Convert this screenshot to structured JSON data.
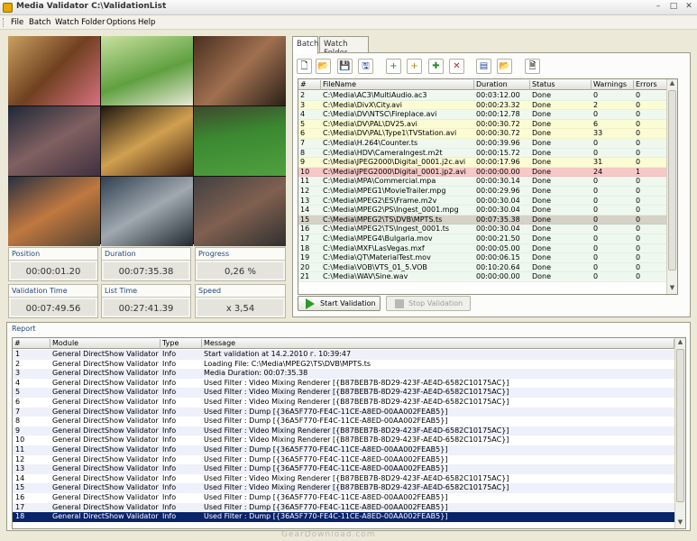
{
  "window": {
    "title": "Media Validator C:\\ValidationList"
  },
  "menu": [
    "File",
    "Batch",
    "Watch Folder",
    "Options",
    "Help"
  ],
  "stats": {
    "position_label": "Position",
    "position_value": "00:00:01.20",
    "duration_label": "Duration",
    "duration_value": "00:07:35.38",
    "progress_label": "Progress",
    "progress_value": "0,26 %",
    "validation_time_label": "Validation Time",
    "validation_time_value": "00:07:49.56",
    "list_time_label": "List Time",
    "list_time_value": "00:27:41.39",
    "speed_label": "Speed",
    "speed_value": "x 3,54"
  },
  "tabs": [
    "Batch",
    "Watch Folder"
  ],
  "batch": {
    "columns": [
      "#",
      "FileName",
      "Duration",
      "Status",
      "Warnings",
      "Errors"
    ],
    "rows": [
      [
        "2",
        "C:\\Media\\AC3\\MultiAudio.ac3",
        "00:03:12.00",
        "Done",
        "0",
        "0"
      ],
      [
        "3",
        "C:\\Media\\DivX\\City.avi",
        "00:00:23.32",
        "Done",
        "2",
        "0"
      ],
      [
        "4",
        "C:\\Media\\DV\\NTSC\\Fireplace.avi",
        "00:00:12.78",
        "Done",
        "0",
        "0"
      ],
      [
        "5",
        "C:\\Media\\DV\\PAL\\DV25.avi",
        "00:00:30.72",
        "Done",
        "6",
        "0"
      ],
      [
        "6",
        "C:\\Media\\DV\\PAL\\Type1\\TVStation.avi",
        "00:00:30.72",
        "Done",
        "33",
        "0"
      ],
      [
        "7",
        "C:\\Media\\H.264\\Counter.ts",
        "00:00:39.96",
        "Done",
        "0",
        "0"
      ],
      [
        "8",
        "C:\\Media\\HDV\\CameraIngest.m2t",
        "00:00:15.72",
        "Done",
        "0",
        "0"
      ],
      [
        "9",
        "C:\\Media\\JPEG2000\\Digital_0001.j2c.avi",
        "00:00:17.96",
        "Done",
        "31",
        "0"
      ],
      [
        "10",
        "C:\\Media\\JPEG2000\\Digital_0001.jp2.avi",
        "00:00:00.00",
        "Done",
        "24",
        "1"
      ],
      [
        "11",
        "C:\\Media\\MPA\\Commercial.mpa",
        "00:00:30.14",
        "Done",
        "0",
        "0"
      ],
      [
        "12",
        "C:\\Media\\MPEG1\\MovieTrailer.mpg",
        "00:00:29.96",
        "Done",
        "0",
        "0"
      ],
      [
        "13",
        "C:\\Media\\MPEG2\\ES\\Frame.m2v",
        "00:00:30.04",
        "Done",
        "0",
        "0"
      ],
      [
        "14",
        "C:\\Media\\MPEG2\\PS\\Ingest_0001.mpg",
        "00:00:30.04",
        "Done",
        "0",
        "0"
      ],
      [
        "15",
        "C:\\Media\\MPEG2\\TS\\DVB\\MPTS.ts",
        "00:07:35.38",
        "Done",
        "0",
        "0"
      ],
      [
        "16",
        "C:\\Media\\MPEG2\\TS\\Ingest_0001.ts",
        "00:00:30.04",
        "Done",
        "0",
        "0"
      ],
      [
        "17",
        "C:\\Media\\MPEG4\\Bulgaria.mov",
        "00:00:21.50",
        "Done",
        "0",
        "0"
      ],
      [
        "18",
        "C:\\Media\\MXF\\LasVegas.mxf",
        "00:00:05.00",
        "Done",
        "0",
        "0"
      ],
      [
        "19",
        "C:\\Media\\QT\\MaterialTest.mov",
        "00:00:06.15",
        "Done",
        "0",
        "0"
      ],
      [
        "20",
        "C:\\Media\\VOB\\VTS_01_5.VOB",
        "00:10:20.64",
        "Done",
        "0",
        "0"
      ],
      [
        "21",
        "C:\\Media\\WAV\\Sine.wav",
        "00:00:00.00",
        "Done",
        "0",
        "0"
      ]
    ],
    "row_colors": [
      "#eef8ee",
      "#fbfbd4",
      "#eef8ee",
      "#fbfbd4",
      "#fbfbd4",
      "#eef8ee",
      "#eef8ee",
      "#fbfbd4",
      "#f6c8c8",
      "#eef8ee",
      "#eef8ee",
      "#eef8ee",
      "#eef8ee",
      "#d6d2c8",
      "#eef8ee",
      "#eef8ee",
      "#eef8ee",
      "#eef8ee",
      "#eef8ee",
      "#eef8ee"
    ],
    "start_label": "Start Validation",
    "stop_label": "Stop Validation"
  },
  "report": {
    "title": "Report",
    "columns": [
      "#",
      "Module",
      "Type",
      "Message"
    ],
    "rows": [
      [
        "1",
        "General DirectShow Validator",
        "Info",
        "Start validation at 14.2.2010 г. 10:39:47"
      ],
      [
        "2",
        "General DirectShow Validator",
        "Info",
        "Loading File: C:\\Media\\MPEG2\\TS\\DVB\\MPTS.ts"
      ],
      [
        "3",
        "General DirectShow Validator",
        "Info",
        "Media Duration: 00:07:35.38"
      ],
      [
        "4",
        "General DirectShow Validator",
        "Info",
        "Used Filter : Video Mixing Renderer [{B87BEB7B-8D29-423F-AE4D-6582C10175AC}]"
      ],
      [
        "5",
        "General DirectShow Validator",
        "Info",
        "Used Filter : Video Mixing Renderer [{B87BEB7B-8D29-423F-AE4D-6582C10175AC}]"
      ],
      [
        "6",
        "General DirectShow Validator",
        "Info",
        "Used Filter : Video Mixing Renderer [{B87BEB7B-8D29-423F-AE4D-6582C10175AC}]"
      ],
      [
        "7",
        "General DirectShow Validator",
        "Info",
        "Used Filter : Dump [{36A5F770-FE4C-11CE-A8ED-00AA002FEAB5}]"
      ],
      [
        "8",
        "General DirectShow Validator",
        "Info",
        "Used Filter : Dump [{36A5F770-FE4C-11CE-A8ED-00AA002FEAB5}]"
      ],
      [
        "9",
        "General DirectShow Validator",
        "Info",
        "Used Filter : Video Mixing Renderer [{B87BEB7B-8D29-423F-AE4D-6582C10175AC}]"
      ],
      [
        "10",
        "General DirectShow Validator",
        "Info",
        "Used Filter : Video Mixing Renderer [{B87BEB7B-8D29-423F-AE4D-6582C10175AC}]"
      ],
      [
        "11",
        "General DirectShow Validator",
        "Info",
        "Used Filter : Dump [{36A5F770-FE4C-11CE-A8ED-00AA002FEAB5}]"
      ],
      [
        "12",
        "General DirectShow Validator",
        "Info",
        "Used Filter : Dump [{36A5F770-FE4C-11CE-A8ED-00AA002FEAB5}]"
      ],
      [
        "13",
        "General DirectShow Validator",
        "Info",
        "Used Filter : Dump [{36A5F770-FE4C-11CE-A8ED-00AA002FEAB5}]"
      ],
      [
        "14",
        "General DirectShow Validator",
        "Info",
        "Used Filter : Video Mixing Renderer [{B87BEB7B-8D29-423F-AE4D-6582C10175AC}]"
      ],
      [
        "15",
        "General DirectShow Validator",
        "Info",
        "Used Filter : Video Mixing Renderer [{B87BEB7B-8D29-423F-AE4D-6582C10175AC}]"
      ],
      [
        "16",
        "General DirectShow Validator",
        "Info",
        "Used Filter : Dump [{36A5F770-FE4C-11CE-A8ED-00AA002FEAB5}]"
      ],
      [
        "17",
        "General DirectShow Validator",
        "Info",
        "Used Filter : Dump [{36A5F770-FE4C-11CE-A8ED-00AA002FEAB5}]"
      ],
      [
        "18",
        "General DirectShow Validator",
        "Info",
        "Used Filter : Dump [{36A5F770-FE4C-11CE-A8ED-00AA002FEAB5}]"
      ]
    ]
  },
  "watermark": "GearDownload.com"
}
